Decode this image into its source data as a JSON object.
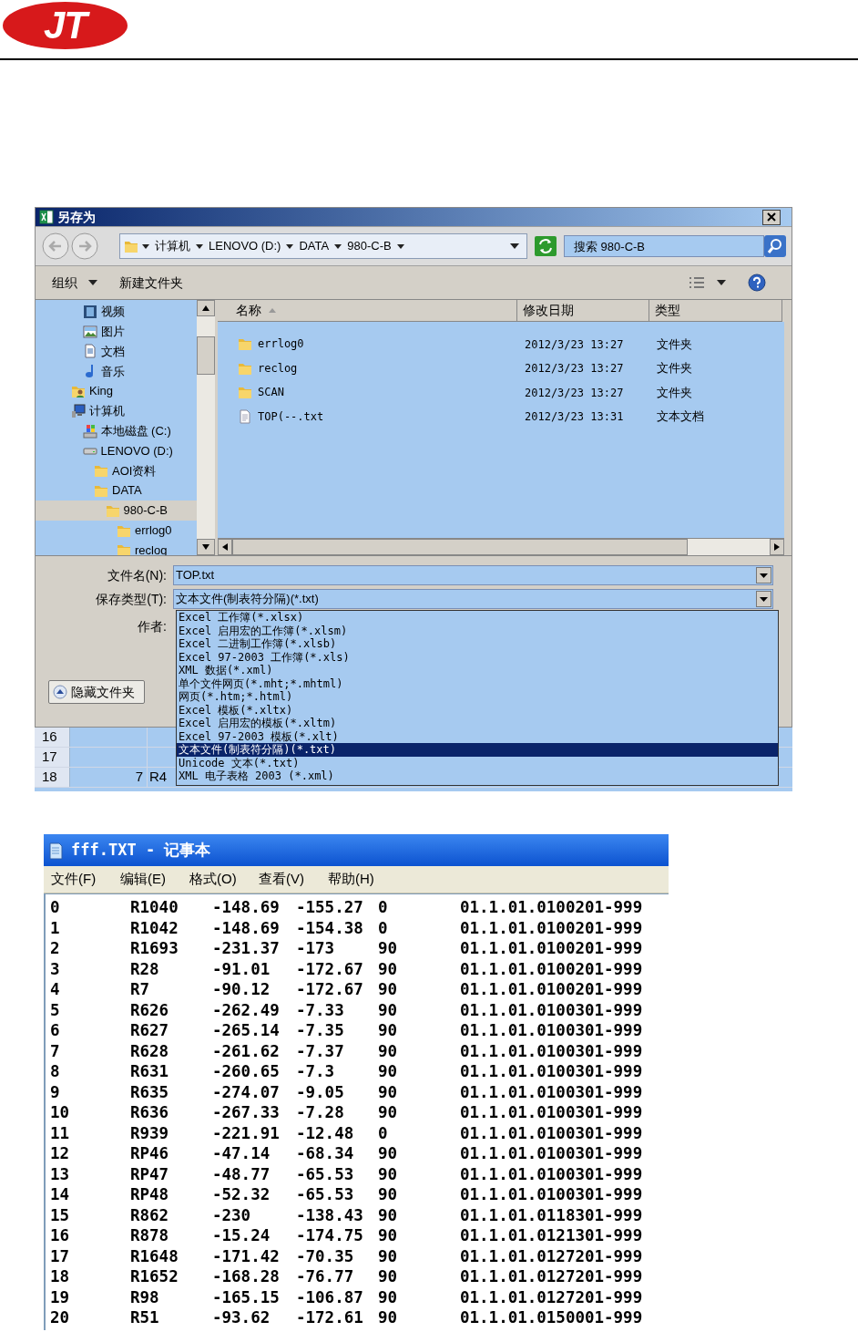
{
  "header": {
    "logo": "JT"
  },
  "save_dialog": {
    "title": "另存为",
    "breadcrumbs": [
      "计算机",
      "LENOVO (D:)",
      "DATA",
      "980-C-B"
    ],
    "search": {
      "placeholder": "搜索 980-C-B"
    },
    "toolbar": {
      "organize": "组织",
      "new_folder": "新建文件夹"
    },
    "library_items": [
      {
        "label": "视频",
        "kind": "video",
        "selected": false
      },
      {
        "label": "图片",
        "kind": "picture",
        "selected": false
      },
      {
        "label": "文档",
        "kind": "document",
        "selected": false
      },
      {
        "label": "音乐",
        "kind": "music",
        "selected": false
      }
    ],
    "tree": [
      {
        "label": "King",
        "kind": "user",
        "selected": false
      },
      {
        "label": "计算机",
        "kind": "computer",
        "selected": false,
        "children": [
          {
            "label": "本地磁盘 (C:)",
            "kind": "system-disk",
            "selected": false
          },
          {
            "label": "LENOVO (D:)",
            "kind": "disk",
            "selected": false,
            "children": [
              {
                "label": "AOI资料",
                "kind": "folder",
                "selected": false
              },
              {
                "label": "DATA",
                "kind": "folder",
                "selected": false,
                "children": [
                  {
                    "label": "980-C-B",
                    "kind": "folder",
                    "selected": true,
                    "children": [
                      {
                        "label": "errlog0",
                        "kind": "folder",
                        "selected": false
                      },
                      {
                        "label": "reclog",
                        "kind": "folder",
                        "selected": false
                      }
                    ]
                  }
                ]
              }
            ]
          }
        ]
      }
    ],
    "columns": [
      "名称",
      "修改日期",
      "类型"
    ],
    "files": [
      {
        "name": "errlog0",
        "date": "2012/3/23 13:27",
        "type": "文件夹",
        "kind": "folder"
      },
      {
        "name": "reclog",
        "date": "2012/3/23 13:27",
        "type": "文件夹",
        "kind": "folder"
      },
      {
        "name": "SCAN",
        "date": "2012/3/23 13:27",
        "type": "文件夹",
        "kind": "folder"
      },
      {
        "name": "TOP(--.txt",
        "date": "2012/3/23 13:31",
        "type": "文本文档",
        "kind": "file"
      }
    ],
    "file_name": {
      "label": "文件名(N):",
      "value": "TOP.txt"
    },
    "save_type": {
      "label": "保存类型(T):",
      "value": "文本文件(制表符分隔)(*.txt)"
    },
    "author": {
      "label": "作者:"
    },
    "hide_folders_button": "隐藏文件夹",
    "type_options": [
      {
        "label": "Excel 工作簿(*.xlsx)",
        "selected": false
      },
      {
        "label": "Excel 启用宏的工作簿(*.xlsm)",
        "selected": false
      },
      {
        "label": "Excel 二进制工作簿(*.xlsb)",
        "selected": false
      },
      {
        "label": "Excel 97-2003 工作簿(*.xls)",
        "selected": false
      },
      {
        "label": "XML 数据(*.xml)",
        "selected": false
      },
      {
        "label": "单个文件网页(*.mht;*.mhtml)",
        "selected": false
      },
      {
        "label": "网页(*.htm;*.html)",
        "selected": false
      },
      {
        "label": "Excel 模板(*.xltx)",
        "selected": false
      },
      {
        "label": "Excel 启用宏的模板(*.xltm)",
        "selected": false
      },
      {
        "label": "Excel 97-2003 模板(*.xlt)",
        "selected": false
      },
      {
        "label": "文本文件(制表符分隔)(*.txt)",
        "selected": true
      },
      {
        "label": "Unicode 文本(*.txt)",
        "selected": false
      },
      {
        "label": "XML 电子表格 2003 (*.xml)",
        "selected": false
      }
    ]
  },
  "spreadsheet": {
    "rows": [
      {
        "header": "16"
      },
      {
        "header": "17"
      },
      {
        "header": "18",
        "cells": [
          "7",
          "R4"
        ]
      }
    ]
  },
  "notepad": {
    "title": "fff.TXT - 记事本",
    "menu": [
      "文件(F)",
      "编辑(E)",
      "格式(O)",
      "查看(V)",
      "帮助(H)"
    ],
    "lines": [
      [
        "0",
        "R1040",
        "-148.69",
        "-155.27",
        "0",
        "01.1.01.0100201-999"
      ],
      [
        "1",
        "R1042",
        "-148.69",
        "-154.38",
        "0",
        "01.1.01.0100201-999"
      ],
      [
        "2",
        "R1693",
        "-231.37",
        "-173",
        "90",
        "01.1.01.0100201-999"
      ],
      [
        "3",
        "R28",
        "-91.01",
        "-172.67",
        "90",
        "01.1.01.0100201-999"
      ],
      [
        "4",
        "R7",
        "-90.12",
        "-172.67",
        "90",
        "01.1.01.0100201-999"
      ],
      [
        "5",
        "R626",
        "-262.49",
        "-7.33",
        "90",
        "01.1.01.0100301-999"
      ],
      [
        "6",
        "R627",
        "-265.14",
        "-7.35",
        "90",
        "01.1.01.0100301-999"
      ],
      [
        "7",
        "R628",
        "-261.62",
        "-7.37",
        "90",
        "01.1.01.0100301-999"
      ],
      [
        "8",
        "R631",
        "-260.65",
        "-7.3",
        "90",
        "01.1.01.0100301-999"
      ],
      [
        "9",
        "R635",
        "-274.07",
        "-9.05",
        "90",
        "01.1.01.0100301-999"
      ],
      [
        "10",
        "R636",
        "-267.33",
        "-7.28",
        "90",
        "01.1.01.0100301-999"
      ],
      [
        "11",
        "R939",
        "-221.91",
        "-12.48",
        "0",
        "01.1.01.0100301-999"
      ],
      [
        "12",
        "RP46",
        "-47.14",
        "-68.34",
        "90",
        "01.1.01.0100301-999"
      ],
      [
        "13",
        "RP47",
        "-48.77",
        "-65.53",
        "90",
        "01.1.01.0100301-999"
      ],
      [
        "14",
        "RP48",
        "-52.32",
        "-65.53",
        "90",
        "01.1.01.0100301-999"
      ],
      [
        "15",
        "R862",
        "-230",
        "-138.43",
        "90",
        "01.1.01.0118301-999"
      ],
      [
        "16",
        "R878",
        "-15.24",
        "-174.75",
        "90",
        "01.1.01.0121301-999"
      ],
      [
        "17",
        "R1648",
        "-171.42",
        "-70.35",
        "90",
        "01.1.01.0127201-999"
      ],
      [
        "18",
        "R1652",
        "-168.28",
        "-76.77",
        "90",
        "01.1.01.0127201-999"
      ],
      [
        "19",
        "R98",
        "-165.15",
        "-106.87",
        "90",
        "01.1.01.0127201-999"
      ],
      [
        "20",
        "R51",
        "-93.62",
        "-172.61",
        "90",
        "01.1.01.0150001-999"
      ]
    ]
  }
}
